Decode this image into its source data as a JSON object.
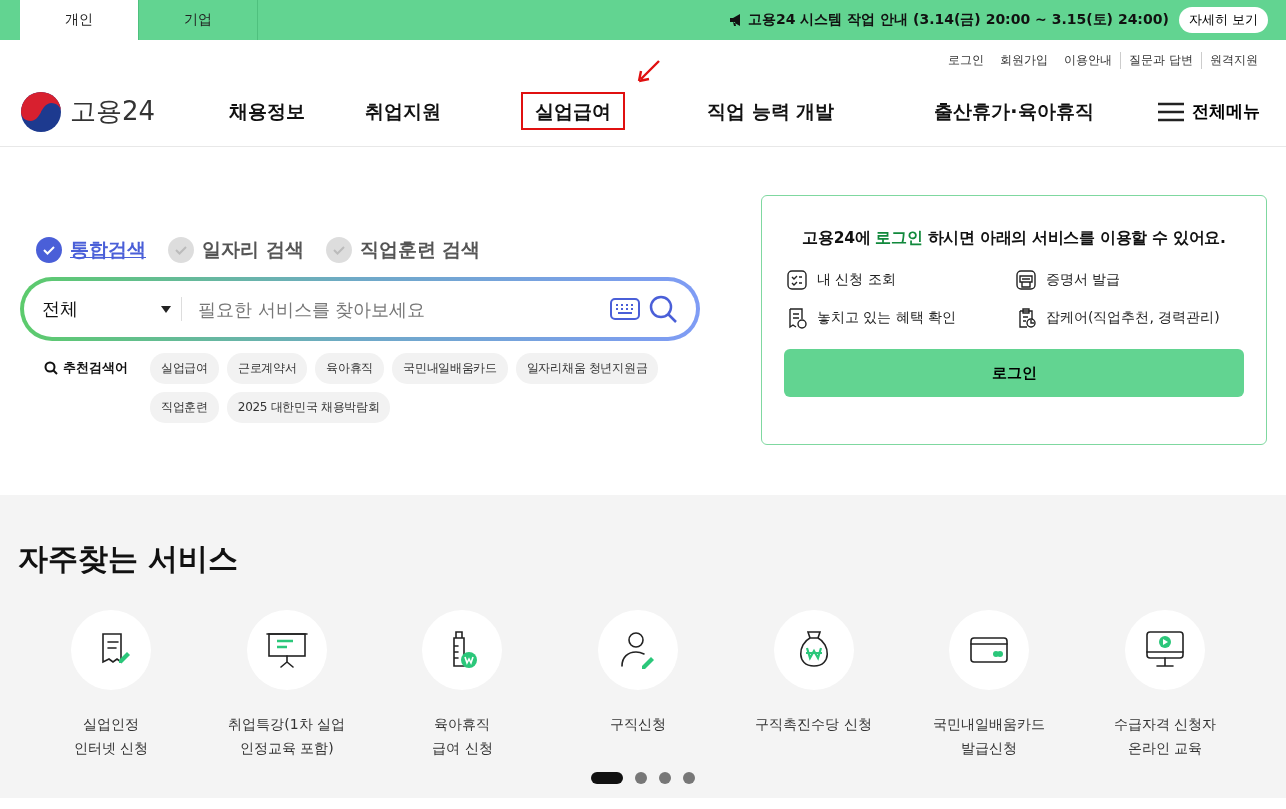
{
  "top_tabs": [
    {
      "label": "개인",
      "selected": true
    },
    {
      "label": "기업",
      "selected": false
    }
  ],
  "notice": {
    "text": "고용24 시스템 작업 안내 (3.14(금) 20:00 ~ 3.15(토) 24:00)",
    "button": "자세히 보기"
  },
  "util_links": [
    "로그인",
    "회원가입",
    "이용안내",
    "질문과 답변",
    "원격지원"
  ],
  "logo": {
    "text": "고용24"
  },
  "nav": [
    {
      "label": "채용정보",
      "highlighted": false
    },
    {
      "label": "취업지원",
      "highlighted": false
    },
    {
      "label": "실업급여",
      "highlighted": true
    },
    {
      "label": "직업 능력 개발",
      "highlighted": false
    },
    {
      "label": "출산휴가·육아휴직",
      "highlighted": false
    }
  ],
  "all_menu": "전체메뉴",
  "search_tabs": [
    {
      "label": "통합검색",
      "selected": true
    },
    {
      "label": "일자리 검색",
      "selected": false
    },
    {
      "label": "직업훈련 검색",
      "selected": false
    }
  ],
  "search": {
    "category": "전체",
    "placeholder": "필요한 서비스를 찾아보세요"
  },
  "recommend": {
    "label": "추천검색어",
    "tags": [
      "실업급여",
      "근로계약서",
      "육아휴직",
      "국민내일배움카드",
      "일자리채움 청년지원금",
      "직업훈련",
      "2025 대한민국 채용박람회"
    ]
  },
  "login_card": {
    "message": "고용24에 **로그인** 하시면 아래의 서비스를 이용할 수 있어요.",
    "services": [
      {
        "label": "내 신청 조회",
        "kind": "checklist"
      },
      {
        "label": "증명서 발급",
        "kind": "printer"
      },
      {
        "label": "놓치고 있는 혜택 확인",
        "kind": "receipt"
      },
      {
        "label": "잡케어(직업추천, 경력관리)",
        "kind": "clipboard"
      }
    ],
    "button": "로그인"
  },
  "frequent": {
    "title": "자주찾는 서비스",
    "items": [
      {
        "label": "실업인정\n인터넷 신청",
        "kind": "document"
      },
      {
        "label": "취업특강(1차 실업\n인정교육 포함)",
        "kind": "board"
      },
      {
        "label": "육아휴직\n급여 신청",
        "kind": "bottle"
      },
      {
        "label": "구직신청",
        "kind": "person"
      },
      {
        "label": "구직촉진수당 신청",
        "kind": "moneybag"
      },
      {
        "label": "국민내일배움카드\n발급신청",
        "kind": "card"
      },
      {
        "label": "수급자격 신청자\n온라인 교육",
        "kind": "monitor"
      }
    ],
    "pages": [
      {
        "selected": true
      },
      {
        "selected": false
      },
      {
        "selected": false
      },
      {
        "selected": false
      }
    ]
  }
}
